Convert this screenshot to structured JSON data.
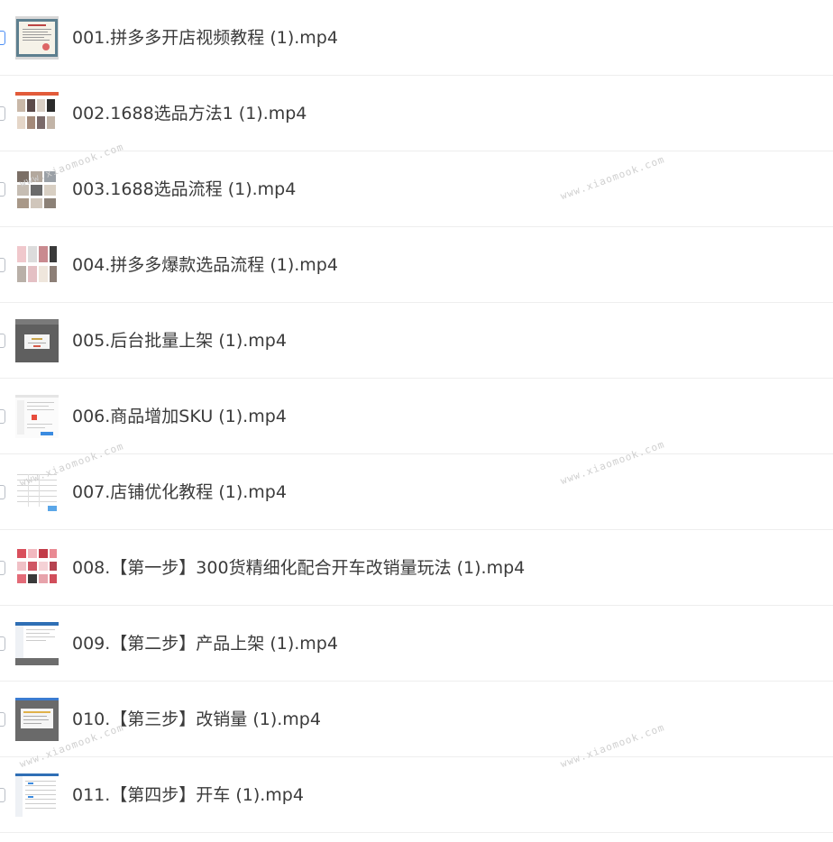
{
  "files": [
    {
      "name": "001.拼多多开店视频教程 (1).mp4",
      "thumb": "certificate-thumbnail"
    },
    {
      "name": "002.1688选品方法1 (1).mp4",
      "thumb": "product-grid-thumbnail"
    },
    {
      "name": "003.1688选品流程 (1).mp4",
      "thumb": "product-grid-thumbnail"
    },
    {
      "name": "004.拼多多爆款选品流程 (1).mp4",
      "thumb": "clothing-grid-thumbnail"
    },
    {
      "name": "005.后台批量上架 (1).mp4",
      "thumb": "dialog-screen-thumbnail"
    },
    {
      "name": "006.商品增加SKU (1).mp4",
      "thumb": "web-form-thumbnail"
    },
    {
      "name": "007.店铺优化教程 (1).mp4",
      "thumb": "spreadsheet-thumbnail"
    },
    {
      "name": "008.【第一步】300货精细化配合开车改销量玩法 (1).mp4",
      "thumb": "product-grid-thumbnail"
    },
    {
      "name": "009.【第二步】产品上架 (1).mp4",
      "thumb": "admin-panel-thumbnail"
    },
    {
      "name": "010.【第三步】改销量 (1).mp4",
      "thumb": "dialog-screen-thumbnail"
    },
    {
      "name": "011.【第四步】开车 (1).mp4",
      "thumb": "admin-panel-thumbnail"
    }
  ],
  "watermark": "www.xiaomook.com"
}
